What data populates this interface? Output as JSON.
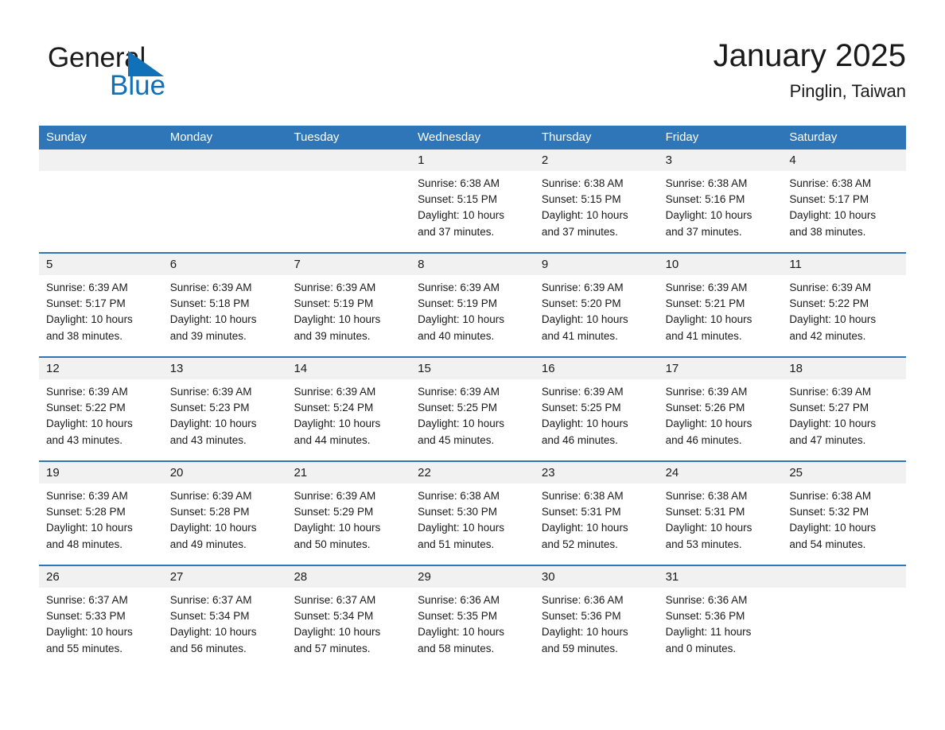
{
  "brand": {
    "name_top": "General",
    "name_bottom": "Blue",
    "color_black": "#1a1a1a",
    "color_blue": "#1070b8"
  },
  "header": {
    "title": "January 2025",
    "subtitle": "Pinglin, Taiwan"
  },
  "theme": {
    "header_bg": "#2e76b8",
    "header_text": "#ffffff",
    "daynum_bg": "#f1f1f1",
    "row_divider": "#2e76b8",
    "cell_text": "#1a1a1a"
  },
  "weekday_headers": [
    "Sunday",
    "Monday",
    "Tuesday",
    "Wednesday",
    "Thursday",
    "Friday",
    "Saturday"
  ],
  "weeks": [
    {
      "days": [
        {
          "num": "",
          "sunrise": "",
          "sunset": "",
          "daylight1": "",
          "daylight2": ""
        },
        {
          "num": "",
          "sunrise": "",
          "sunset": "",
          "daylight1": "",
          "daylight2": ""
        },
        {
          "num": "",
          "sunrise": "",
          "sunset": "",
          "daylight1": "",
          "daylight2": ""
        },
        {
          "num": "1",
          "sunrise": "Sunrise: 6:38 AM",
          "sunset": "Sunset: 5:15 PM",
          "daylight1": "Daylight: 10 hours",
          "daylight2": "and 37 minutes."
        },
        {
          "num": "2",
          "sunrise": "Sunrise: 6:38 AM",
          "sunset": "Sunset: 5:15 PM",
          "daylight1": "Daylight: 10 hours",
          "daylight2": "and 37 minutes."
        },
        {
          "num": "3",
          "sunrise": "Sunrise: 6:38 AM",
          "sunset": "Sunset: 5:16 PM",
          "daylight1": "Daylight: 10 hours",
          "daylight2": "and 37 minutes."
        },
        {
          "num": "4",
          "sunrise": "Sunrise: 6:38 AM",
          "sunset": "Sunset: 5:17 PM",
          "daylight1": "Daylight: 10 hours",
          "daylight2": "and 38 minutes."
        }
      ]
    },
    {
      "days": [
        {
          "num": "5",
          "sunrise": "Sunrise: 6:39 AM",
          "sunset": "Sunset: 5:17 PM",
          "daylight1": "Daylight: 10 hours",
          "daylight2": "and 38 minutes."
        },
        {
          "num": "6",
          "sunrise": "Sunrise: 6:39 AM",
          "sunset": "Sunset: 5:18 PM",
          "daylight1": "Daylight: 10 hours",
          "daylight2": "and 39 minutes."
        },
        {
          "num": "7",
          "sunrise": "Sunrise: 6:39 AM",
          "sunset": "Sunset: 5:19 PM",
          "daylight1": "Daylight: 10 hours",
          "daylight2": "and 39 minutes."
        },
        {
          "num": "8",
          "sunrise": "Sunrise: 6:39 AM",
          "sunset": "Sunset: 5:19 PM",
          "daylight1": "Daylight: 10 hours",
          "daylight2": "and 40 minutes."
        },
        {
          "num": "9",
          "sunrise": "Sunrise: 6:39 AM",
          "sunset": "Sunset: 5:20 PM",
          "daylight1": "Daylight: 10 hours",
          "daylight2": "and 41 minutes."
        },
        {
          "num": "10",
          "sunrise": "Sunrise: 6:39 AM",
          "sunset": "Sunset: 5:21 PM",
          "daylight1": "Daylight: 10 hours",
          "daylight2": "and 41 minutes."
        },
        {
          "num": "11",
          "sunrise": "Sunrise: 6:39 AM",
          "sunset": "Sunset: 5:22 PM",
          "daylight1": "Daylight: 10 hours",
          "daylight2": "and 42 minutes."
        }
      ]
    },
    {
      "days": [
        {
          "num": "12",
          "sunrise": "Sunrise: 6:39 AM",
          "sunset": "Sunset: 5:22 PM",
          "daylight1": "Daylight: 10 hours",
          "daylight2": "and 43 minutes."
        },
        {
          "num": "13",
          "sunrise": "Sunrise: 6:39 AM",
          "sunset": "Sunset: 5:23 PM",
          "daylight1": "Daylight: 10 hours",
          "daylight2": "and 43 minutes."
        },
        {
          "num": "14",
          "sunrise": "Sunrise: 6:39 AM",
          "sunset": "Sunset: 5:24 PM",
          "daylight1": "Daylight: 10 hours",
          "daylight2": "and 44 minutes."
        },
        {
          "num": "15",
          "sunrise": "Sunrise: 6:39 AM",
          "sunset": "Sunset: 5:25 PM",
          "daylight1": "Daylight: 10 hours",
          "daylight2": "and 45 minutes."
        },
        {
          "num": "16",
          "sunrise": "Sunrise: 6:39 AM",
          "sunset": "Sunset: 5:25 PM",
          "daylight1": "Daylight: 10 hours",
          "daylight2": "and 46 minutes."
        },
        {
          "num": "17",
          "sunrise": "Sunrise: 6:39 AM",
          "sunset": "Sunset: 5:26 PM",
          "daylight1": "Daylight: 10 hours",
          "daylight2": "and 46 minutes."
        },
        {
          "num": "18",
          "sunrise": "Sunrise: 6:39 AM",
          "sunset": "Sunset: 5:27 PM",
          "daylight1": "Daylight: 10 hours",
          "daylight2": "and 47 minutes."
        }
      ]
    },
    {
      "days": [
        {
          "num": "19",
          "sunrise": "Sunrise: 6:39 AM",
          "sunset": "Sunset: 5:28 PM",
          "daylight1": "Daylight: 10 hours",
          "daylight2": "and 48 minutes."
        },
        {
          "num": "20",
          "sunrise": "Sunrise: 6:39 AM",
          "sunset": "Sunset: 5:28 PM",
          "daylight1": "Daylight: 10 hours",
          "daylight2": "and 49 minutes."
        },
        {
          "num": "21",
          "sunrise": "Sunrise: 6:39 AM",
          "sunset": "Sunset: 5:29 PM",
          "daylight1": "Daylight: 10 hours",
          "daylight2": "and 50 minutes."
        },
        {
          "num": "22",
          "sunrise": "Sunrise: 6:38 AM",
          "sunset": "Sunset: 5:30 PM",
          "daylight1": "Daylight: 10 hours",
          "daylight2": "and 51 minutes."
        },
        {
          "num": "23",
          "sunrise": "Sunrise: 6:38 AM",
          "sunset": "Sunset: 5:31 PM",
          "daylight1": "Daylight: 10 hours",
          "daylight2": "and 52 minutes."
        },
        {
          "num": "24",
          "sunrise": "Sunrise: 6:38 AM",
          "sunset": "Sunset: 5:31 PM",
          "daylight1": "Daylight: 10 hours",
          "daylight2": "and 53 minutes."
        },
        {
          "num": "25",
          "sunrise": "Sunrise: 6:38 AM",
          "sunset": "Sunset: 5:32 PM",
          "daylight1": "Daylight: 10 hours",
          "daylight2": "and 54 minutes."
        }
      ]
    },
    {
      "days": [
        {
          "num": "26",
          "sunrise": "Sunrise: 6:37 AM",
          "sunset": "Sunset: 5:33 PM",
          "daylight1": "Daylight: 10 hours",
          "daylight2": "and 55 minutes."
        },
        {
          "num": "27",
          "sunrise": "Sunrise: 6:37 AM",
          "sunset": "Sunset: 5:34 PM",
          "daylight1": "Daylight: 10 hours",
          "daylight2": "and 56 minutes."
        },
        {
          "num": "28",
          "sunrise": "Sunrise: 6:37 AM",
          "sunset": "Sunset: 5:34 PM",
          "daylight1": "Daylight: 10 hours",
          "daylight2": "and 57 minutes."
        },
        {
          "num": "29",
          "sunrise": "Sunrise: 6:36 AM",
          "sunset": "Sunset: 5:35 PM",
          "daylight1": "Daylight: 10 hours",
          "daylight2": "and 58 minutes."
        },
        {
          "num": "30",
          "sunrise": "Sunrise: 6:36 AM",
          "sunset": "Sunset: 5:36 PM",
          "daylight1": "Daylight: 10 hours",
          "daylight2": "and 59 minutes."
        },
        {
          "num": "31",
          "sunrise": "Sunrise: 6:36 AM",
          "sunset": "Sunset: 5:36 PM",
          "daylight1": "Daylight: 11 hours",
          "daylight2": "and 0 minutes."
        },
        {
          "num": "",
          "sunrise": "",
          "sunset": "",
          "daylight1": "",
          "daylight2": ""
        }
      ]
    }
  ]
}
